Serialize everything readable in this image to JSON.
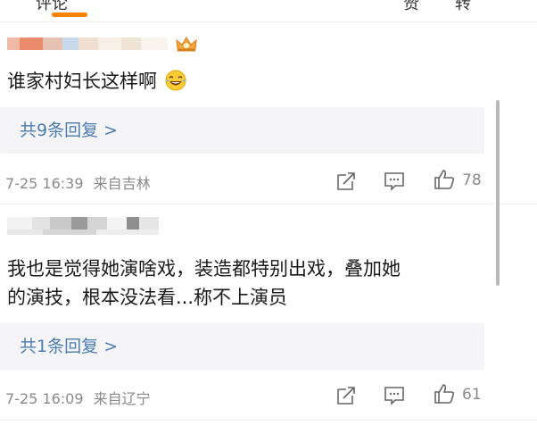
{
  "tabs": {
    "left_partial": "评论",
    "right_partial_a": "赞",
    "right_partial_b": "转"
  },
  "comments": [
    {
      "text": "谁家村妇长这样啊",
      "emoji": "laughing-crying-emoji",
      "reply_label": "共9条回复 >",
      "time": "7-25 16:39",
      "source": "来自吉林",
      "likes": "78"
    },
    {
      "text_line1": "我也是觉得她演啥戏，装造都特别出戏，叠加她",
      "text_line2": "的演技，根本没法看...称不上演员",
      "reply_label": "共1条回复 >",
      "time": "7-25 16:09",
      "source": "来自辽宁",
      "likes": "61"
    }
  ],
  "icons": {
    "badge": "crown-icon",
    "share": "share-icon",
    "comment": "comment-icon",
    "like": "thumbs-up-icon"
  },
  "colors": {
    "accent": "#ff8200",
    "link": "#4d7cb2",
    "meta": "#8a8a8a",
    "reply_bg": "#f5f5f7"
  }
}
